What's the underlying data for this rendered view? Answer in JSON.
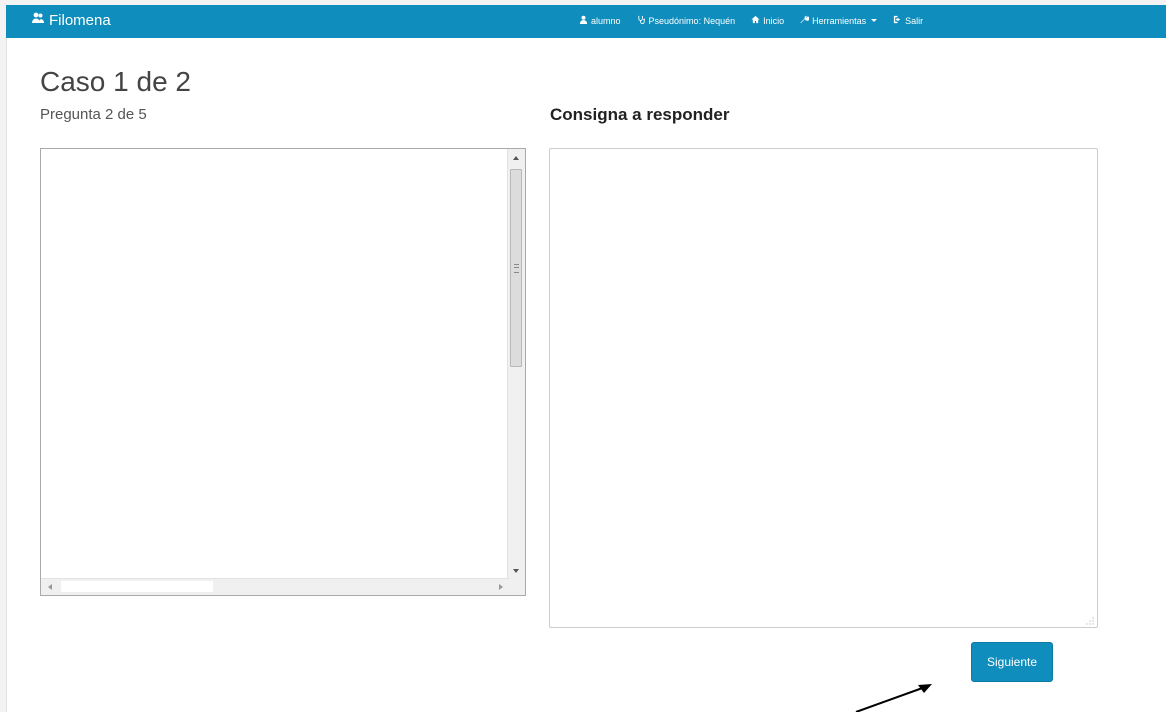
{
  "navbar": {
    "brand": "Filomena",
    "items": [
      {
        "label": "alumno",
        "icon": "user-icon"
      },
      {
        "label": "Pseudónimo: Nequén",
        "icon": "stethoscope-icon"
      },
      {
        "label": "Inicio",
        "icon": "home-icon"
      },
      {
        "label": "Herramientas",
        "icon": "wrench-icon"
      },
      {
        "label": "Salir",
        "icon": "logout-icon"
      }
    ],
    "color": "#0f8ebd"
  },
  "main": {
    "case_title": "Caso 1 de 2",
    "question_counter": "Pregunta 2 de 5",
    "prompt_heading": "Consigna a responder",
    "answer_value": "",
    "next_button": "Siguiente"
  }
}
